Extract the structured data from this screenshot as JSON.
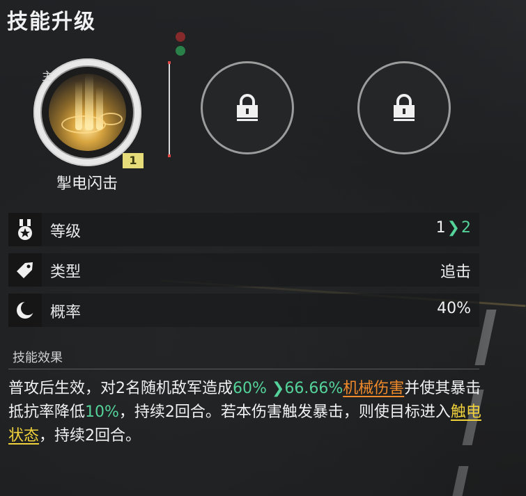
{
  "header": {
    "title": "技能升级"
  },
  "skills": {
    "main": {
      "tag": "主",
      "name": "掣电闪击",
      "level": "1",
      "icon": "lightning-strike-art"
    },
    "locked_slots": [
      {
        "icon": "lock-icon"
      },
      {
        "icon": "lock-icon"
      }
    ]
  },
  "stats": [
    {
      "icon": "medal-icon",
      "label": "等级",
      "from": "1",
      "to": "2"
    },
    {
      "icon": "tag-icon",
      "label": "类型",
      "value": "追击"
    },
    {
      "icon": "moon-icon",
      "label": "概率",
      "value": "40%"
    }
  ],
  "effect": {
    "heading": "技能效果",
    "parts": {
      "p1": "普攻后生效，对2名随机敌军造成",
      "v1": "60%",
      "v2": "66.66%",
      "dmg": "机械伤害",
      "p2": "并使其暴击抵抗率降低",
      "v3": "10%",
      "p3": "，持续2回合。若本伤害触发暴击，则使目标进入",
      "status": "触电状态",
      "p4": "，持续2回合。"
    }
  },
  "colors": {
    "accent_green": "#54d39a",
    "damage_orange": "#f08a2a",
    "status_yellow": "#f2d23c",
    "level_badge": "#e6dc7a"
  }
}
